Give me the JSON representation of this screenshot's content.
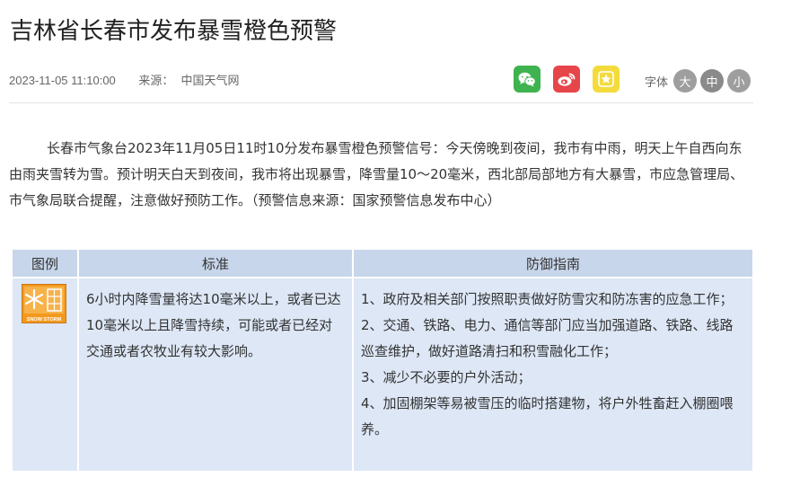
{
  "article": {
    "title": "吉林省长春市发布暴雪橙色预警",
    "datetime": "2023-11-05 11:10:00",
    "source_label": "来源：",
    "source_name": "中国天气网",
    "body": "长春市气象台2023年11月05日11时10分发布暴雪橙色预警信号：今天傍晚到夜间，我市有中雨，明天上午自西向东由雨夹雪转为雪。预计明天白天到夜间，我市将出现暴雪，降雪量10～20毫米，西北部局部地方有大暴雪，市应急管理局、市气象局联合提醒，注意做好预防工作。（预警信息来源：国家预警信息发布中心）"
  },
  "share": {
    "items": [
      {
        "name": "wechat",
        "icon": "wechat-icon",
        "color": "#3fb34f"
      },
      {
        "name": "weibo",
        "icon": "weibo-icon",
        "color": "#e6454a"
      },
      {
        "name": "favorite",
        "icon": "star-icon",
        "color": "#f3db3c"
      }
    ]
  },
  "font_size": {
    "label": "字体",
    "large": "大",
    "medium": "中",
    "small": "小"
  },
  "table": {
    "headers": [
      "图例",
      "标准",
      "防御指南"
    ],
    "legend_icon": {
      "name": "snowstorm-orange-warning-icon",
      "text": "SNOW STORM",
      "color": "#f39a1e"
    },
    "standard": "6小时内降雪量将达10毫米以上，或者已达10毫米以上且降雪持续，可能或者已经对交通或者农牧业有较大影响。",
    "guide": [
      "1、政府及相关部门按照职责做好防雪灾和防冻害的应急工作；",
      "2、交通、铁路、电力、通信等部门应当加强道路、铁路、线路巡查维护，做好道路清扫和积雪融化工作；",
      "3、减少不必要的户外活动；",
      "4、加固棚架等易被雪压的临时搭建物，将户外牲畜赶入棚圈喂养。"
    ]
  }
}
